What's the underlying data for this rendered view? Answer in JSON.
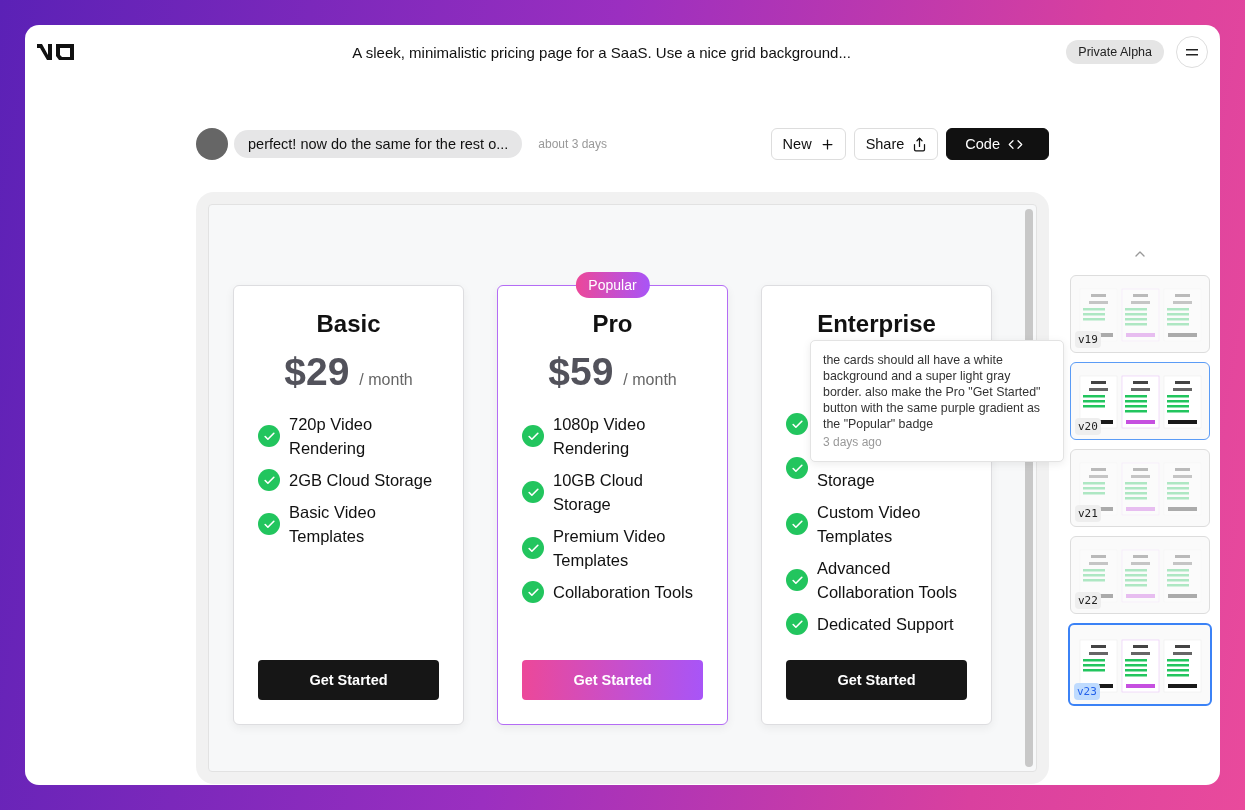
{
  "header": {
    "title": "A sleek, minimalistic pricing page for a SaaS. Use a nice grid background...",
    "badge": "Private Alpha"
  },
  "chat": {
    "message": "perfect! now do the same for the rest o...",
    "time": "about 3 days",
    "buttons": [
      {
        "label": "New",
        "kind": "new"
      },
      {
        "label": "Share",
        "kind": "share"
      },
      {
        "label": "Code",
        "kind": "code"
      }
    ]
  },
  "plans": [
    {
      "name": "Basic",
      "price": "$29",
      "period": "/ month",
      "popular": false,
      "button": "Get Started",
      "features": [
        {
          "text": "720p Video Rendering"
        },
        {
          "text": "2GB Cloud Storage"
        },
        {
          "text": "Basic Video Templates"
        }
      ]
    },
    {
      "name": "Pro",
      "price": "$59",
      "period": "/ month",
      "popular": true,
      "badge": "Popular",
      "button": "Get Started",
      "features": [
        {
          "text": "1080p Video Rendering"
        },
        {
          "text": "10GB Cloud Storage"
        },
        {
          "text": "Premium Video Templates"
        },
        {
          "text": "Collaboration Tools"
        }
      ]
    },
    {
      "name": "Enterprise",
      "popular": false,
      "button": "Get Started",
      "features": [
        {
          "covered": true
        },
        {
          "text": "Storage",
          "covered": true
        },
        {
          "text": "Custom Video Templates"
        },
        {
          "text": "Advanced Collaboration Tools"
        },
        {
          "text": "Dedicated Support"
        }
      ]
    }
  ],
  "tooltip": {
    "text": "the cards should all have a white background and a super light gray border. also make the Pro \"Get Started\" button with the same purple gradient as the \"Popular\" badge",
    "time": "3 days ago"
  },
  "versions": [
    {
      "label": "v19",
      "selected": false,
      "hovered": false,
      "faded": true
    },
    {
      "label": "v20",
      "selected": false,
      "hovered": true,
      "faded": false
    },
    {
      "label": "v21",
      "selected": false,
      "hovered": false,
      "faded": true
    },
    {
      "label": "v22",
      "selected": false,
      "hovered": false,
      "faded": true
    },
    {
      "label": "v23",
      "selected": true,
      "hovered": false,
      "faded": false
    }
  ]
}
